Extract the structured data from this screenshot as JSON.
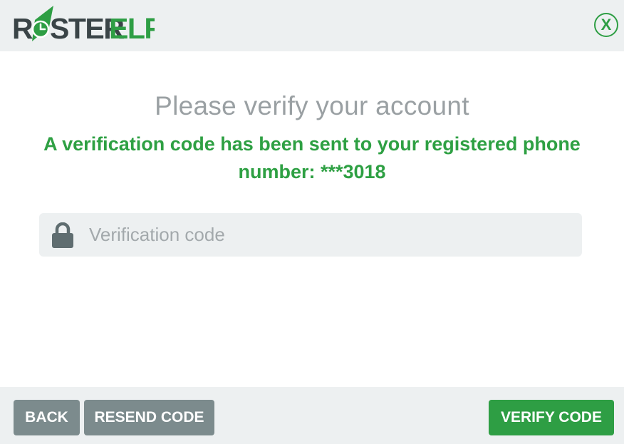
{
  "header": {
    "logo": {
      "text_part1": "R",
      "text_part2": "STER",
      "text_part3": "ELF",
      "full_text": "ROSTERELF",
      "colors": {
        "dark": "#3a4447",
        "green": "#2e9e44"
      }
    },
    "close_label": "X"
  },
  "main": {
    "title": "Please verify your account",
    "message": "A verification code has been sent to your registered phone number: ***3018",
    "code_field": {
      "placeholder": "Verification code",
      "value": "",
      "icon": "lock-icon"
    }
  },
  "footer": {
    "back_label": "BACK",
    "resend_label": "RESEND CODE",
    "verify_label": "VERIFY CODE"
  },
  "colors": {
    "accent_green": "#2e9e44",
    "message_green": "#2ea043",
    "button_gray": "#7c8b8d",
    "panel_gray": "#edf0f1",
    "title_gray": "#9aa0a3"
  }
}
